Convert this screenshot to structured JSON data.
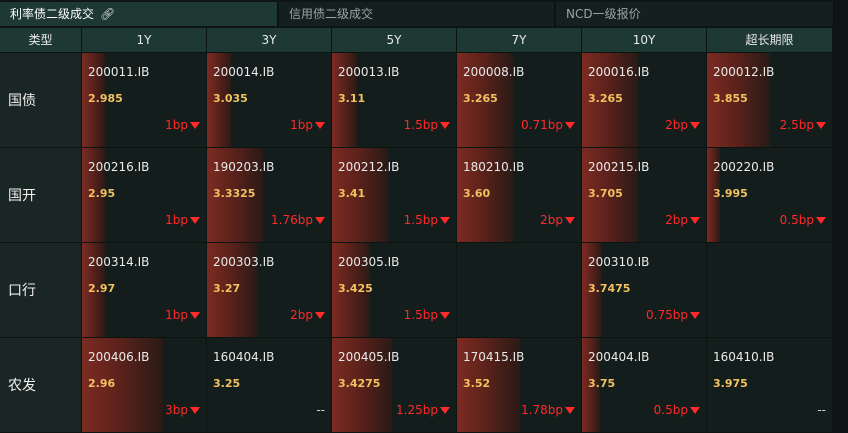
{
  "tabs": [
    {
      "label": "利率债二级成交",
      "active": true,
      "icon": "link-icon"
    },
    {
      "label": "信用债二级成交",
      "active": false
    },
    {
      "label": "NCD一级报价",
      "active": false
    }
  ],
  "headers": [
    "类型",
    "1Y",
    "3Y",
    "5Y",
    "7Y",
    "10Y",
    "超长期限"
  ],
  "rows": [
    {
      "label": "国债",
      "cells": [
        {
          "code": "200011.IB",
          "yield": "2.985",
          "change": "1bp",
          "dir": "down",
          "bar": 0.18
        },
        {
          "code": "200014.IB",
          "yield": "3.035",
          "change": "1bp",
          "dir": "down",
          "bar": 0.19
        },
        {
          "code": "200013.IB",
          "yield": "3.11",
          "change": "1.5bp",
          "dir": "down",
          "bar": 0.2
        },
        {
          "code": "200008.IB",
          "yield": "3.265",
          "change": "0.71bp",
          "dir": "down",
          "bar": 0.45
        },
        {
          "code": "200016.IB",
          "yield": "3.265",
          "change": "2bp",
          "dir": "down",
          "bar": 0.45
        },
        {
          "code": "200012.IB",
          "yield": "3.855",
          "change": "2.5bp",
          "dir": "down",
          "bar": 0.5
        }
      ]
    },
    {
      "label": "国开",
      "cells": [
        {
          "code": "200216.IB",
          "yield": "2.95",
          "change": "1bp",
          "dir": "down",
          "bar": 0.18
        },
        {
          "code": "190203.IB",
          "yield": "3.3325",
          "change": "1.76bp",
          "dir": "down",
          "bar": 0.45
        },
        {
          "code": "200212.IB",
          "yield": "3.41",
          "change": "1.5bp",
          "dir": "down",
          "bar": 0.45
        },
        {
          "code": "180210.IB",
          "yield": "3.60",
          "change": "2bp",
          "dir": "down",
          "bar": 0.45
        },
        {
          "code": "200215.IB",
          "yield": "3.705",
          "change": "2bp",
          "dir": "down",
          "bar": 0.45
        },
        {
          "code": "200220.IB",
          "yield": "3.995",
          "change": "0.5bp",
          "dir": "down",
          "bar": 0.1
        }
      ]
    },
    {
      "label": "口行",
      "cells": [
        {
          "code": "200314.IB",
          "yield": "2.97",
          "change": "1bp",
          "dir": "down",
          "bar": 0.18
        },
        {
          "code": "200303.IB",
          "yield": "3.27",
          "change": "2bp",
          "dir": "down",
          "bar": 0.4
        },
        {
          "code": "200305.IB",
          "yield": "3.425",
          "change": "1.5bp",
          "dir": "down",
          "bar": 0.3
        },
        {
          "code": "",
          "yield": "",
          "change": "",
          "dir": "",
          "bar": 0
        },
        {
          "code": "200310.IB",
          "yield": "3.7475",
          "change": "0.75bp",
          "dir": "down",
          "bar": 0.16
        },
        {
          "code": "",
          "yield": "",
          "change": "",
          "dir": "",
          "bar": 0
        }
      ]
    },
    {
      "label": "农发",
      "cells": [
        {
          "code": "200406.IB",
          "yield": "2.96",
          "change": "3bp",
          "dir": "down",
          "bar": 0.65
        },
        {
          "code": "160404.IB",
          "yield": "3.25",
          "change": "--",
          "dir": "none",
          "bar": 0
        },
        {
          "code": "200405.IB",
          "yield": "3.4275",
          "change": "1.25bp",
          "dir": "down",
          "bar": 0.48
        },
        {
          "code": "170415.IB",
          "yield": "3.52",
          "change": "1.78bp",
          "dir": "down",
          "bar": 0.5
        },
        {
          "code": "200404.IB",
          "yield": "3.75",
          "change": "0.5bp",
          "dir": "down",
          "bar": 0.14
        },
        {
          "code": "160410.IB",
          "yield": "3.975",
          "change": "--",
          "dir": "none",
          "bar": 0
        }
      ]
    }
  ]
}
